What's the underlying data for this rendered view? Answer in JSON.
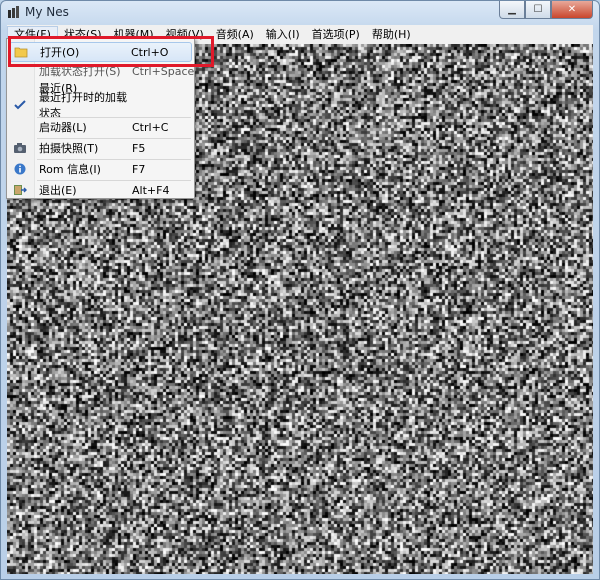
{
  "window": {
    "title": "My Nes",
    "min_glyph": "▁",
    "max_glyph": "☐",
    "close_glyph": "✕"
  },
  "menubar": [
    {
      "label": "文件(F)",
      "active": true
    },
    {
      "label": "状态(S)"
    },
    {
      "label": "机器(M)"
    },
    {
      "label": "视频(V)"
    },
    {
      "label": "音频(A)"
    },
    {
      "label": "输入(I)"
    },
    {
      "label": "首选项(P)"
    },
    {
      "label": "帮助(H)"
    }
  ],
  "file_menu": {
    "items": [
      {
        "label": "打开(O)",
        "shortcut": "Ctrl+O",
        "icon": "folder-icon",
        "highlighted": true
      },
      {
        "label": "加载状态打开(S)",
        "shortcut": "Ctrl+Space",
        "icon": ""
      },
      {
        "label": "最近(R)",
        "shortcut": "",
        "icon": ""
      },
      {
        "label": "最近打开时的加载状态",
        "shortcut": "",
        "icon": "checkmark-icon",
        "checked": true
      },
      {
        "label": "启动器(L)",
        "shortcut": "Ctrl+C",
        "icon": ""
      },
      {
        "label": "拍摄快照(T)",
        "shortcut": "F5",
        "icon": "camera-icon"
      },
      {
        "label": "Rom 信息(I)",
        "shortcut": "F7",
        "icon": "info-icon"
      },
      {
        "label": "退出(E)",
        "shortcut": "Alt+F4",
        "icon": "exit-icon"
      }
    ]
  },
  "colors": {
    "highlight_box": "#e0192a",
    "noise_light": "#ffffff",
    "noise_dark": "#1a1a1a"
  }
}
